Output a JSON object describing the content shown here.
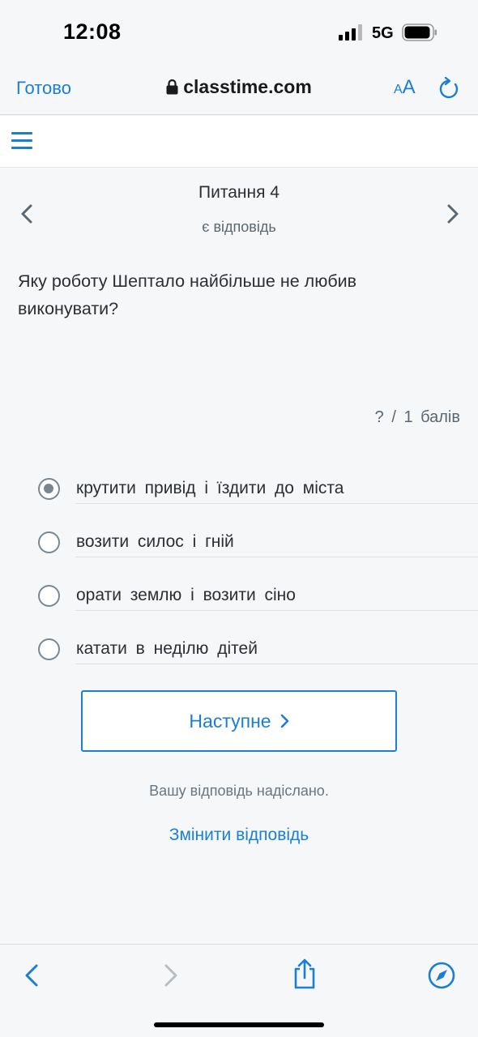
{
  "status_bar": {
    "time": "12:08",
    "network": "5G"
  },
  "browser": {
    "done_label": "Готово",
    "url": "classtime.com",
    "text_size_small": "A",
    "text_size_big": "A"
  },
  "question": {
    "title": "Питання 4",
    "status": "є відповідь",
    "text": "Яку роботу Шептало найбільше не любив виконувати?",
    "points": "? / 1 балів"
  },
  "options": [
    {
      "label": "крутити привід і їздити до міста",
      "selected": true
    },
    {
      "label": "возити силос і гній",
      "selected": false
    },
    {
      "label": "орати землю і возити сіно",
      "selected": false
    },
    {
      "label": "катати в неділю дітей",
      "selected": false
    }
  ],
  "next_button": {
    "label": "Наступне"
  },
  "submitted_message": "Вашу відповідь надіслано.",
  "change_answer_label": "Змінити відповідь",
  "colors": {
    "accent": "#1a7fd4",
    "radio": "#7b8790"
  },
  "icons": [
    "lock-icon",
    "reload-icon",
    "hamburger-icon",
    "back-icon",
    "forward-icon",
    "share-icon",
    "compass-icon"
  ]
}
